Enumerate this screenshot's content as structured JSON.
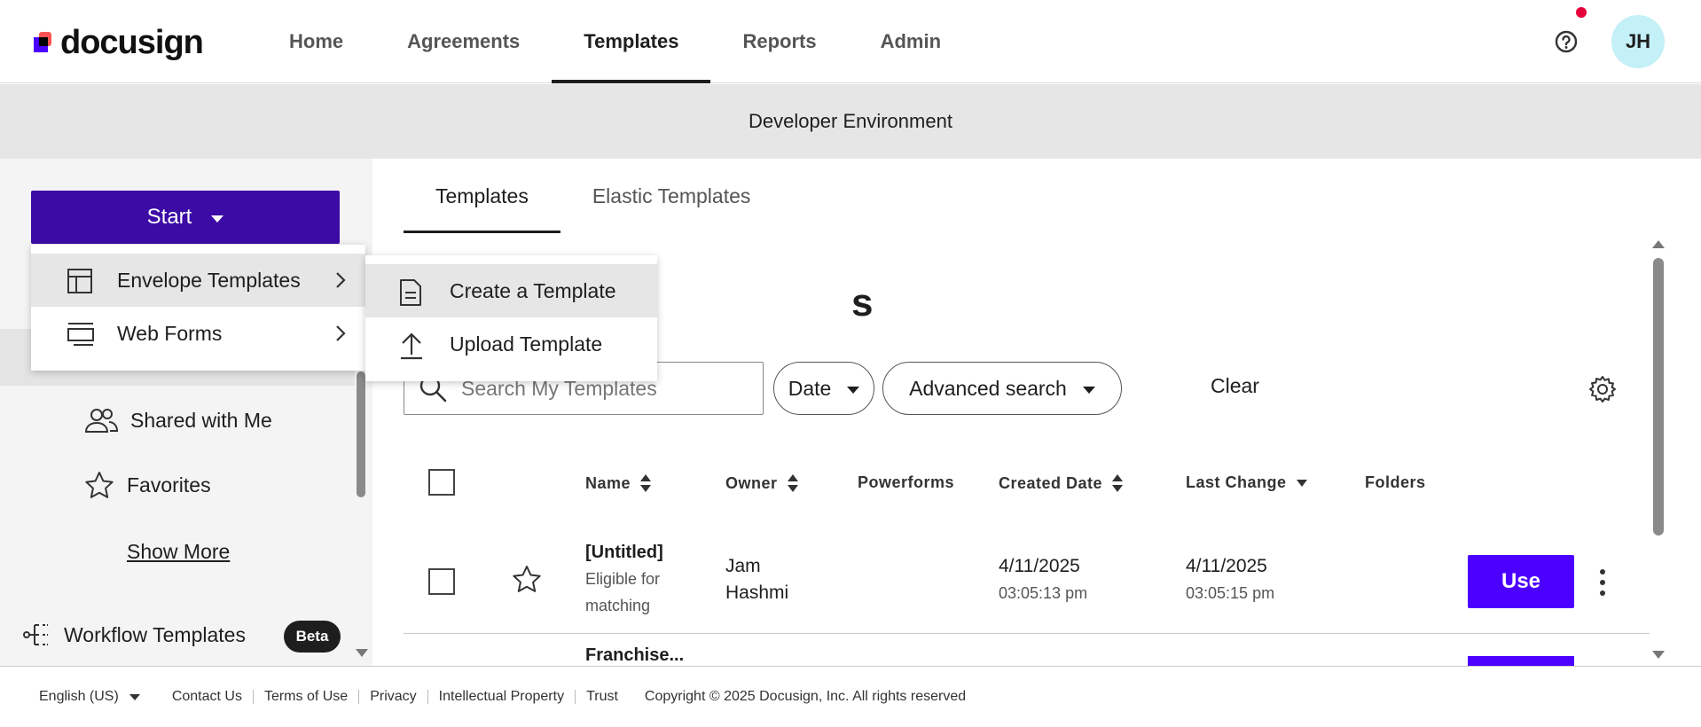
{
  "app": {
    "brand": "docusign",
    "brand_color": "#3c0ba6",
    "accent_color": "#4c00ff"
  },
  "nav": {
    "items": [
      {
        "label": "Home"
      },
      {
        "label": "Agreements"
      },
      {
        "label": "Templates",
        "active": true
      },
      {
        "label": "Reports"
      },
      {
        "label": "Admin"
      }
    ]
  },
  "user": {
    "initials": "JH"
  },
  "environment_banner": "Developer Environment",
  "sidebar": {
    "start_label": "Start",
    "items": [
      {
        "label": "Shared with Me",
        "icon": "users-icon"
      },
      {
        "label": "Favorites",
        "icon": "star-icon"
      }
    ],
    "show_more": "Show More",
    "workflow": {
      "label": "Workflow Templates",
      "badge": "Beta"
    }
  },
  "start_menu": {
    "items": [
      {
        "label": "Envelope Templates",
        "icon": "template-icon",
        "highlighted": true
      },
      {
        "label": "Web Forms",
        "icon": "webform-icon"
      }
    ],
    "submenu": [
      {
        "label": "Create a Template",
        "icon": "document-icon",
        "highlighted": true
      },
      {
        "label": "Upload Template",
        "icon": "upload-icon"
      }
    ]
  },
  "main": {
    "tabs": [
      {
        "label": "Templates",
        "active": true
      },
      {
        "label": "Elastic Templates"
      }
    ],
    "heading_fragment": "s",
    "search": {
      "placeholder": "Search My Templates"
    },
    "filters": {
      "date": "Date",
      "advanced": "Advanced search",
      "clear": "Clear"
    },
    "columns": [
      "Name",
      "Owner",
      "Powerforms",
      "Created Date",
      "Last Change",
      "Folders"
    ],
    "rows": [
      {
        "name": "[Untitled]",
        "status": "Eligible for matching",
        "status_l1": "Eligible for",
        "status_l2": "matching",
        "owner_l1": "Jam",
        "owner_l2": "Hashmi",
        "created_date": "4/11/2025",
        "created_time": "03:05:13 pm",
        "changed_date": "4/11/2025",
        "changed_time": "03:05:15 pm",
        "action": "Use"
      },
      {
        "name": "Franchise..."
      }
    ]
  },
  "footer": {
    "language": "English (US)",
    "links": [
      "Contact Us",
      "Terms of Use",
      "Privacy",
      "Intellectual Property",
      "Trust"
    ],
    "copyright": "Copyright © 2025 Docusign, Inc. All rights reserved"
  }
}
